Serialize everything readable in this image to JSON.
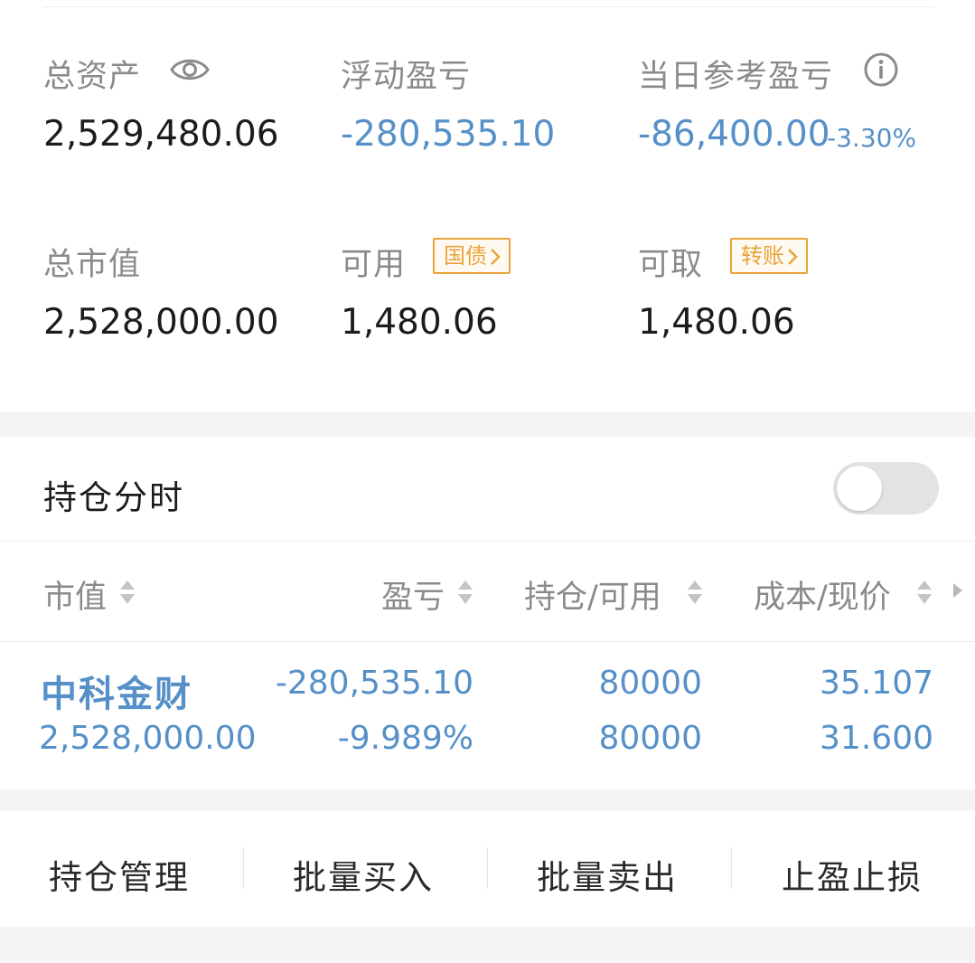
{
  "summary": {
    "total_assets_label": "总资产",
    "total_assets_value": "2,529,480.06",
    "floating_pl_label": "浮动盈亏",
    "floating_pl_value": "-280,535.10",
    "daily_pl_label": "当日参考盈亏",
    "daily_pl_value": "-86,400.00",
    "daily_pl_pct": "-3.30%",
    "market_value_label": "总市值",
    "market_value_value": "2,528,000.00",
    "available_label": "可用",
    "available_tag": "国债",
    "available_value": "1,480.06",
    "withdrawable_label": "可取",
    "withdrawable_tag": "转账",
    "withdrawable_value": "1,480.06"
  },
  "holdings": {
    "title": "持仓分时",
    "toggle_on": false,
    "columns": [
      "市值",
      "盈亏",
      "持仓/可用",
      "成本/现价"
    ],
    "rows": [
      {
        "name": "中科金财",
        "market_value": "2,528,000.00",
        "pl": "-280,535.10",
        "pl_pct": "-9.989%",
        "position": "80000",
        "available": "80000",
        "cost": "35.107",
        "price": "31.600"
      }
    ]
  },
  "actions": [
    "持仓管理",
    "批量买入",
    "批量卖出",
    "止盈止损"
  ],
  "colors": {
    "loss_blue": "#5690c8",
    "tag_orange": "#e8a33a",
    "label_gray": "#8a8a8a"
  },
  "icons": [
    "eye-icon",
    "info-icon",
    "chevron-right-icon",
    "sort-icon",
    "triangle-right-icon"
  ]
}
